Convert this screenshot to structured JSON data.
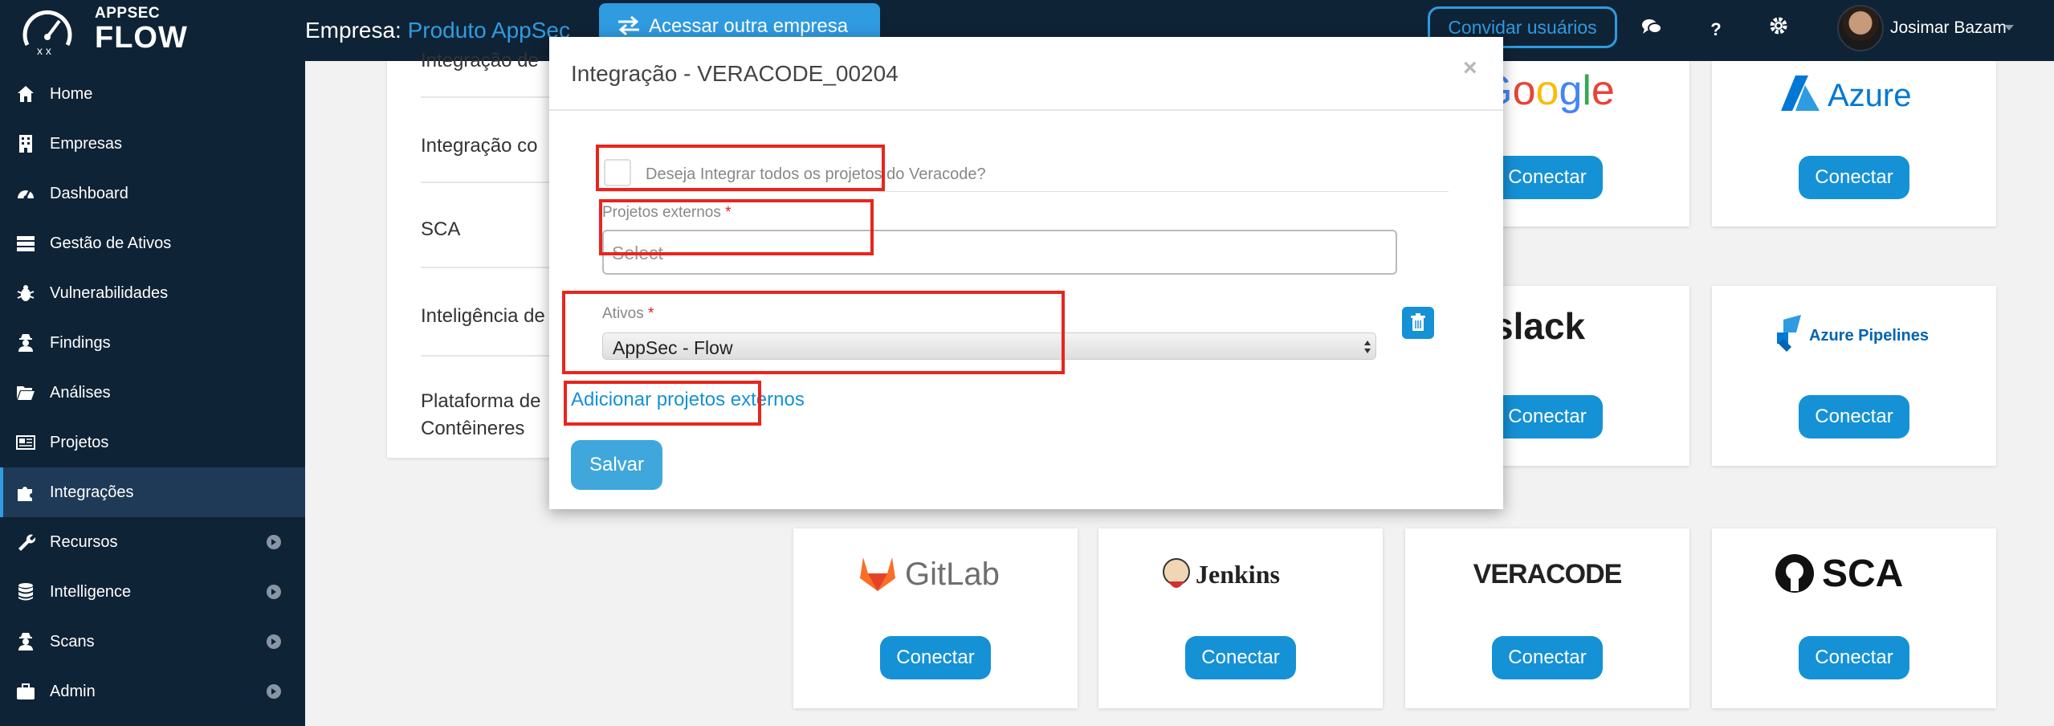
{
  "header": {
    "logo_top": "APPSEC",
    "logo_bottom": "FLOW",
    "empresa_label": "Empresa: ",
    "empresa_name": "Produto AppSec",
    "switch_company": "Acessar outra empresa",
    "invite_users": "Convidar usuários",
    "chat_icon": "chat-icon",
    "help_label": "?",
    "settings_icon": "gear-icon",
    "user_name": "Josimar Bazam"
  },
  "sidebar": {
    "items": [
      {
        "label": "Home",
        "icon": "home-icon"
      },
      {
        "label": "Empresas",
        "icon": "building-icon"
      },
      {
        "label": "Dashboard",
        "icon": "dashboard-icon"
      },
      {
        "label": "Gestão de Ativos",
        "icon": "server-icon"
      },
      {
        "label": "Vulnerabilidades",
        "icon": "bug-icon"
      },
      {
        "label": "Findings",
        "icon": "user-secret-icon"
      },
      {
        "label": "Análises",
        "icon": "folder-open-icon"
      },
      {
        "label": "Projetos",
        "icon": "newspaper-icon"
      },
      {
        "label": "Integrações",
        "icon": "puzzle-icon",
        "active": true
      },
      {
        "label": "Recursos",
        "icon": "wrench-icon",
        "expandable": true
      },
      {
        "label": "Intelligence",
        "icon": "database-icon",
        "expandable": true
      },
      {
        "label": "Scans",
        "icon": "user-secret-icon",
        "expandable": true
      },
      {
        "label": "Admin",
        "icon": "briefcase-icon",
        "expandable": true
      }
    ]
  },
  "background": {
    "categories": [
      "Integração de",
      "Integração co",
      "SCA",
      "Inteligência de",
      "Plataforma de",
      "Contêineres"
    ],
    "cards": [
      {
        "name": "Google",
        "button": "Conectar"
      },
      {
        "name": "Azure",
        "button": "Conectar"
      },
      {
        "name": "slack",
        "button": "Conectar"
      },
      {
        "name": "Azure Pipelines",
        "button": "Conectar"
      },
      {
        "name": "GitLab",
        "button": "Conectar"
      },
      {
        "name": "Jenkins",
        "button": "Conectar"
      },
      {
        "name": "VERACODE",
        "button": "Conectar"
      },
      {
        "name": "SCA",
        "button": "Conectar"
      }
    ]
  },
  "modal": {
    "title": "Integração - VERACODE_00204",
    "close": "×",
    "integrate_all_label": "Deseja Integrar todos os projetos do Veracode?",
    "external_projects_label": "Projetos externos",
    "required_mark": "*",
    "external_projects_placeholder": "Select",
    "assets_label": "Ativos",
    "assets_value": "AppSec - Flow",
    "add_external_projects": "Adicionar projetos externos",
    "save": "Salvar"
  },
  "colors": {
    "sidebar_bg": "#0f2336",
    "accent": "#1591d6",
    "highlight_box": "#e8251d"
  }
}
